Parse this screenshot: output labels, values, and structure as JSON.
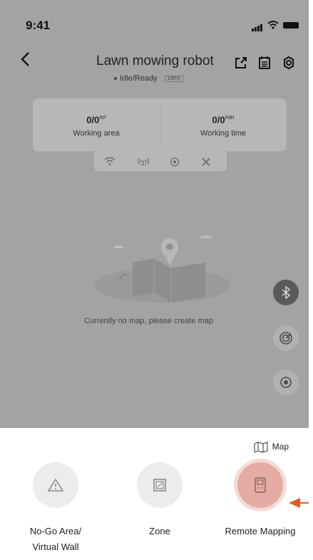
{
  "status_bar": {
    "time": "9:41"
  },
  "header": {
    "title": "Lawn mowing robot",
    "status_text": "Idle/Ready",
    "battery_badge": "100%"
  },
  "stats": {
    "area_value": "0/0",
    "area_unit": "m²",
    "area_label": "Working area",
    "time_value": "0/0",
    "time_unit": "min",
    "time_label": "Working time"
  },
  "status_icons": [
    "wifi-icon",
    "signal-antenna-icon",
    "gps-icon",
    "blade-icon"
  ],
  "map": {
    "empty_message": "Currently no map, please create map"
  },
  "floating_buttons": [
    "bluetooth-icon",
    "radar-icon",
    "locate-icon"
  ],
  "panel": {
    "map_label": "Map",
    "modes": [
      {
        "label_line1": "No-Go Area/",
        "label_line2": "Virtual Wall",
        "icon": "warning-icon"
      },
      {
        "label_line1": "Zone",
        "label_line2": "",
        "icon": "zone-icon"
      },
      {
        "label_line1": "Remote Mapping",
        "label_line2": "",
        "icon": "remote-icon",
        "active": true
      }
    ]
  },
  "colors": {
    "overlay": "#a3a3a3",
    "active_mode": "#e4aca3",
    "pointer_arrow": "#e05a2a"
  }
}
